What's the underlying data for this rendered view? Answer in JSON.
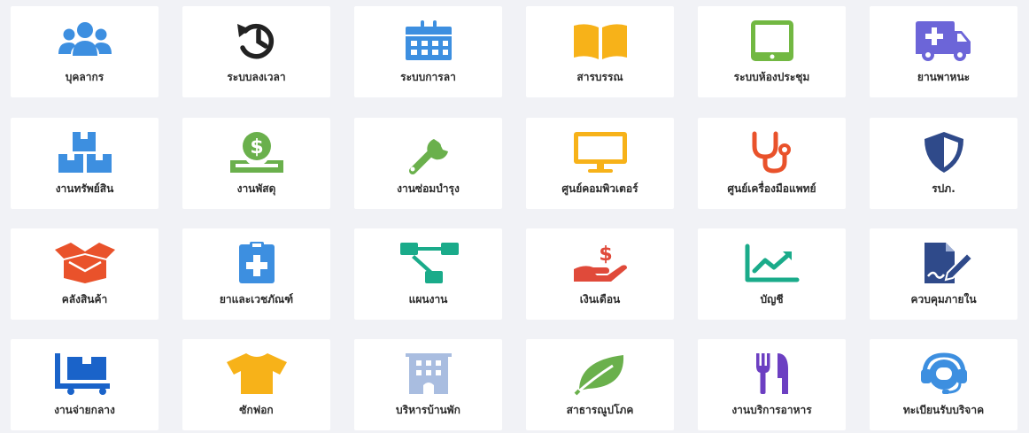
{
  "modules": [
    {
      "label": "บุคลากร",
      "icon": "users-icon",
      "color": "#3d8fe0"
    },
    {
      "label": "ระบบลงเวลา",
      "icon": "history-clock-icon",
      "color": "#222222"
    },
    {
      "label": "ระบบการลา",
      "icon": "calendar-icon",
      "color": "#3d8fe0"
    },
    {
      "label": "สารบรรณ",
      "icon": "open-book-icon",
      "color": "#f7b219"
    },
    {
      "label": "ระบบห้องประชุม",
      "icon": "tablet-icon",
      "color": "#72b842"
    },
    {
      "label": "ยานพาหนะ",
      "icon": "ambulance-icon",
      "color": "#6c65d8"
    },
    {
      "label": "งานทรัพย์สิน",
      "icon": "boxes-icon",
      "color": "#3d8fe0"
    },
    {
      "label": "งานพัสดุ",
      "icon": "coin-hand-icon",
      "color": "#6ab04c"
    },
    {
      "label": "งานซ่อมบำรุง",
      "icon": "wrench-icon",
      "color": "#6ab04c"
    },
    {
      "label": "ศูนย์คอมพิวเตอร์",
      "icon": "monitor-icon",
      "color": "#f7b219"
    },
    {
      "label": "ศูนย์เครื่องมือแพทย์",
      "icon": "stethoscope-icon",
      "color": "#e9522b"
    },
    {
      "label": "รปภ.",
      "icon": "shield-icon",
      "color": "#2f4a8a"
    },
    {
      "label": "คลังสินค้า",
      "icon": "open-box-icon",
      "color": "#e9522b"
    },
    {
      "label": "ยาและเวชภัณฑ์",
      "icon": "medical-clipboard-icon",
      "color": "#3d8fe0"
    },
    {
      "label": "แผนงาน",
      "icon": "sitemap-icon",
      "color": "#1aab8a"
    },
    {
      "label": "เงินเดือน",
      "icon": "money-hand-icon",
      "color": "#e04a3a"
    },
    {
      "label": "บัญชี",
      "icon": "line-chart-icon",
      "color": "#1aab8a"
    },
    {
      "label": "ควบคุมภายใน",
      "icon": "signed-document-icon",
      "color": "#2f4a8a"
    },
    {
      "label": "งานจ่ายกลาง",
      "icon": "dolly-icon",
      "color": "#1a63c9"
    },
    {
      "label": "ซักฟอก",
      "icon": "tshirt-icon",
      "color": "#f7b219"
    },
    {
      "label": "บริหารบ้านพัก",
      "icon": "building-icon",
      "color": "#a9bde0"
    },
    {
      "label": "สาธารณูปโภค",
      "icon": "leaf-icon",
      "color": "#6ab04c"
    },
    {
      "label": "งานบริการอาหาร",
      "icon": "utensils-icon",
      "color": "#6c3fc2"
    },
    {
      "label": "ทะเบียนรับบริจาค",
      "icon": "headset-icon",
      "color": "#3d8fe0"
    }
  ]
}
